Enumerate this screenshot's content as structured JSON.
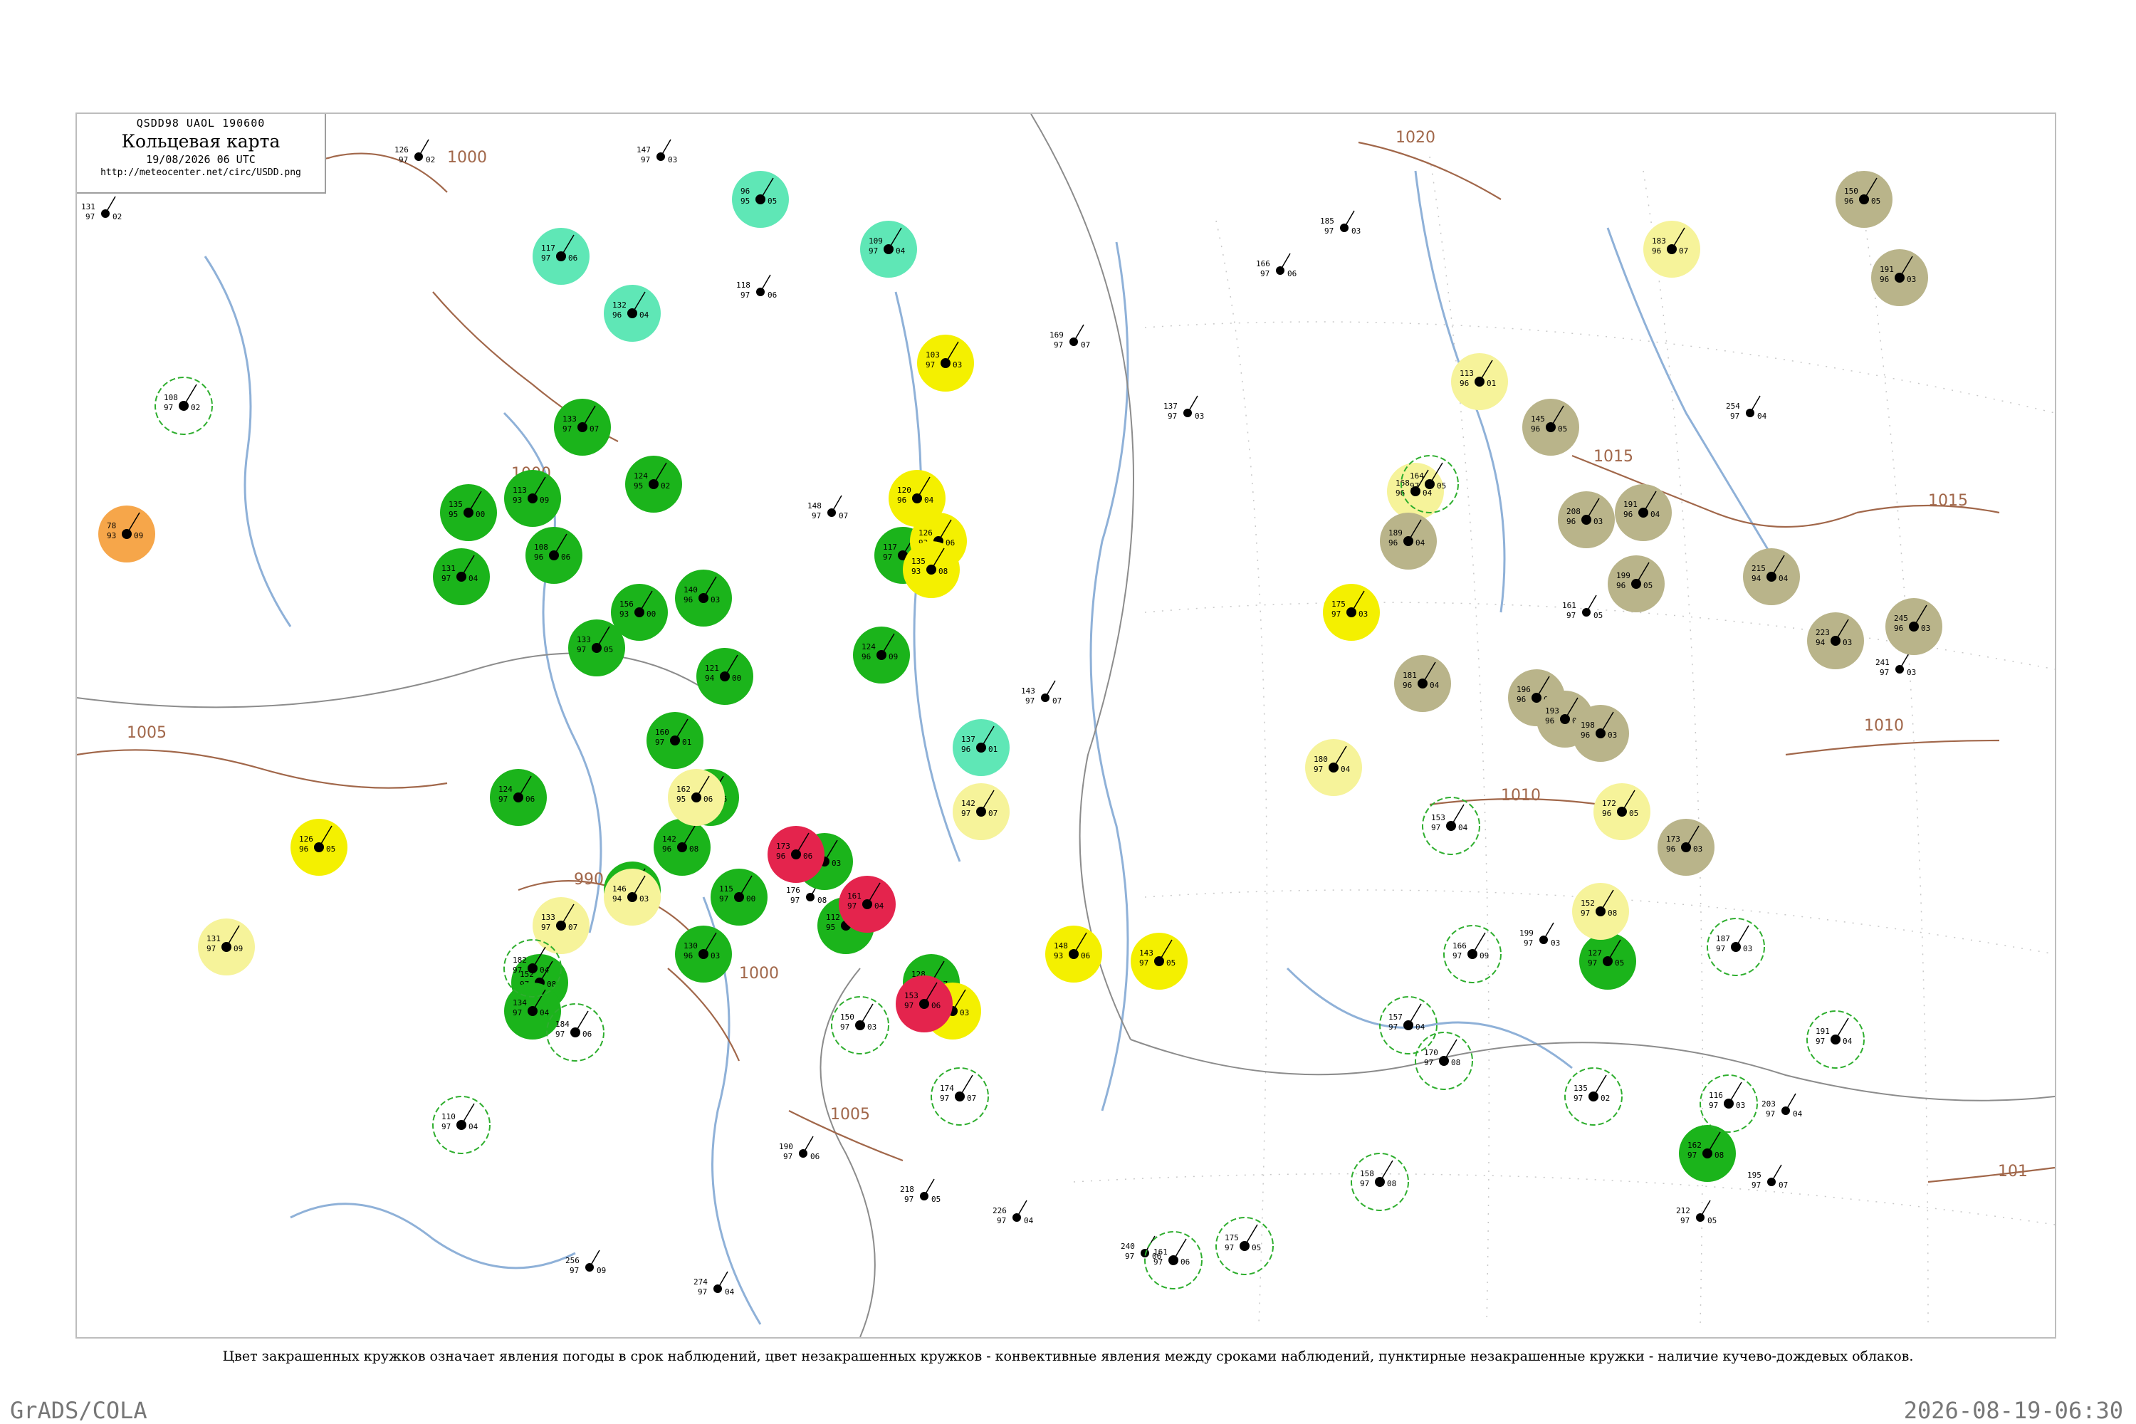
{
  "header": {
    "code_line": "QSDD98  UAOL  190600",
    "title": "Кольцевая карта",
    "date_line": "19/08/2026 06 UTC",
    "url": "http://meteocenter.net/circ/USDD.png"
  },
  "caption": "Цвет закрашенных кружков означает явления погоды в срок наблюдений, цвет незакрашенных кружков - конвективные явления между сроками наблюдений, пунктирные незакрашенные кружки - наличие кучево-дождевых облаков.",
  "footer": {
    "left": "GrADS/COLA",
    "right": "2026-08-19-06:30"
  },
  "colors": {
    "rain_fill": "#1bb41b",
    "shower_ring": "#2eae2e",
    "yellow_fill": "#f4f000",
    "pale_yellow_fill": "#f6f39a",
    "olive_fill": "#b9b48a",
    "red_fill": "#e4244d",
    "orange_fill": "#f6a64a",
    "teal_fill": "#5fe7b6",
    "isobar": "#a1674a",
    "river": "#8fb1d8",
    "border": "#8c8c8c"
  },
  "isobars": [
    {
      "label": "1000"
    },
    {
      "label": "1000"
    },
    {
      "label": "1005"
    },
    {
      "label": "990"
    },
    {
      "label": "1000"
    },
    {
      "label": "1005"
    },
    {
      "label": "1020"
    },
    {
      "label": "1015"
    },
    {
      "label": "1015"
    },
    {
      "label": "1010"
    },
    {
      "label": "1010"
    },
    {
      "label": "101"
    }
  ],
  "stations": [
    {
      "type": "rain_fill",
      "t": "133",
      "p": "97",
      "w": "07"
    },
    {
      "type": "rain_fill",
      "t": "113",
      "p": "93",
      "w": "09"
    },
    {
      "type": "rain_fill",
      "t": "124",
      "p": "95",
      "w": "02"
    },
    {
      "type": "rain_fill",
      "t": "117",
      "p": "97",
      "w": "05"
    },
    {
      "type": "rain_fill",
      "t": "108",
      "p": "96",
      "w": "06"
    },
    {
      "type": "rain_fill",
      "t": "156",
      "p": "93",
      "w": "00"
    },
    {
      "type": "rain_fill",
      "t": "140",
      "p": "96",
      "w": "03"
    },
    {
      "type": "rain_fill",
      "t": "121",
      "p": "94",
      "w": "00"
    },
    {
      "type": "rain_fill",
      "t": "135",
      "p": "95",
      "w": "00"
    },
    {
      "type": "rain_fill",
      "t": "131",
      "p": "97",
      "w": "04"
    },
    {
      "type": "rain_fill",
      "t": "160",
      "p": "97",
      "w": "01"
    },
    {
      "type": "rain_fill",
      "t": "124",
      "p": "96",
      "w": "09"
    },
    {
      "type": "rain_fill",
      "t": "133",
      "p": "97",
      "w": "05"
    },
    {
      "type": "rain_fill",
      "t": "146",
      "p": "96",
      "w": "06"
    },
    {
      "type": "rain_fill",
      "t": "142",
      "p": "96",
      "w": "08"
    },
    {
      "type": "rain_fill",
      "t": "115",
      "p": "97",
      "w": "00"
    },
    {
      "type": "rain_fill",
      "t": "126",
      "p": "97",
      "w": "03"
    },
    {
      "type": "rain_fill",
      "t": "112",
      "p": "95",
      "w": "04"
    },
    {
      "type": "rain_fill",
      "t": "131",
      "p": "97",
      "w": "01"
    },
    {
      "type": "rain_fill",
      "t": "130",
      "p": "96",
      "w": "03"
    },
    {
      "type": "rain_fill",
      "t": "152",
      "p": "97",
      "w": "08"
    },
    {
      "type": "rain_fill",
      "t": "134",
      "p": "97",
      "w": "04"
    },
    {
      "type": "rain_fill",
      "t": "124",
      "p": "97",
      "w": "06"
    },
    {
      "type": "rain_fill",
      "t": "128",
      "p": "96",
      "w": "07"
    },
    {
      "type": "rain_fill",
      "t": "127",
      "p": "97",
      "w": "05"
    },
    {
      "type": "rain_fill",
      "t": "162",
      "p": "97",
      "w": "08"
    },
    {
      "type": "yellow_fill",
      "t": "126",
      "p": "93",
      "w": "06"
    },
    {
      "type": "yellow_fill",
      "t": "120",
      "p": "96",
      "w": "04"
    },
    {
      "type": "yellow_fill",
      "t": "135",
      "p": "93",
      "w": "08"
    },
    {
      "type": "yellow_fill",
      "t": "103",
      "p": "97",
      "w": "03"
    },
    {
      "type": "yellow_fill",
      "t": "126",
      "p": "96",
      "w": "05"
    },
    {
      "type": "yellow_fill",
      "t": "175",
      "p": "97",
      "w": "03"
    },
    {
      "type": "yellow_fill",
      "t": "148",
      "p": "93",
      "w": "06"
    },
    {
      "type": "yellow_fill",
      "t": "143",
      "p": "97",
      "w": "05"
    },
    {
      "type": "yellow_fill",
      "t": "169",
      "p": "93",
      "w": "03"
    },
    {
      "type": "pale_yellow_fill",
      "t": "131",
      "p": "97",
      "w": "09"
    },
    {
      "type": "pale_yellow_fill",
      "t": "146",
      "p": "94",
      "w": "03"
    },
    {
      "type": "pale_yellow_fill",
      "t": "162",
      "p": "95",
      "w": "06"
    },
    {
      "type": "pale_yellow_fill",
      "t": "142",
      "p": "97",
      "w": "07"
    },
    {
      "type": "pale_yellow_fill",
      "t": "183",
      "p": "96",
      "w": "07"
    },
    {
      "type": "pale_yellow_fill",
      "t": "168",
      "p": "96",
      "w": "04"
    },
    {
      "type": "pale_yellow_fill",
      "t": "113",
      "p": "96",
      "w": "01"
    },
    {
      "type": "pale_yellow_fill",
      "t": "180",
      "p": "97",
      "w": "04"
    },
    {
      "type": "pale_yellow_fill",
      "t": "172",
      "p": "96",
      "w": "05"
    },
    {
      "type": "pale_yellow_fill",
      "t": "152",
      "p": "97",
      "w": "08"
    },
    {
      "type": "pale_yellow_fill",
      "t": "133",
      "p": "97",
      "w": "07"
    },
    {
      "type": "olive_fill",
      "t": "150",
      "p": "96",
      "w": "05"
    },
    {
      "type": "olive_fill",
      "t": "191",
      "p": "96",
      "w": "03"
    },
    {
      "type": "olive_fill",
      "t": "145",
      "p": "96",
      "w": "05"
    },
    {
      "type": "olive_fill",
      "t": "189",
      "p": "96",
      "w": "04"
    },
    {
      "type": "olive_fill",
      "t": "208",
      "p": "96",
      "w": "03"
    },
    {
      "type": "olive_fill",
      "t": "191",
      "p": "96",
      "w": "04"
    },
    {
      "type": "olive_fill",
      "t": "199",
      "p": "96",
      "w": "05"
    },
    {
      "type": "olive_fill",
      "t": "181",
      "p": "96",
      "w": "04"
    },
    {
      "type": "olive_fill",
      "t": "196",
      "p": "96",
      "w": "02"
    },
    {
      "type": "olive_fill",
      "t": "193",
      "p": "96",
      "w": "07"
    },
    {
      "type": "olive_fill",
      "t": "198",
      "p": "96",
      "w": "03"
    },
    {
      "type": "olive_fill",
      "t": "215",
      "p": "94",
      "w": "04"
    },
    {
      "type": "olive_fill",
      "t": "223",
      "p": "94",
      "w": "03"
    },
    {
      "type": "olive_fill",
      "t": "245",
      "p": "96",
      "w": "03"
    },
    {
      "type": "olive_fill",
      "t": "173",
      "p": "96",
      "w": "03"
    },
    {
      "type": "red_fill",
      "t": "173",
      "p": "96",
      "w": "06"
    },
    {
      "type": "red_fill",
      "t": "161",
      "p": "97",
      "w": "04"
    },
    {
      "type": "red_fill",
      "t": "153",
      "p": "97",
      "w": "06"
    },
    {
      "type": "orange_fill",
      "t": "78",
      "p": "93",
      "w": "09"
    },
    {
      "type": "teal_fill",
      "t": "117",
      "p": "97",
      "w": "06"
    },
    {
      "type": "teal_fill",
      "t": "132",
      "p": "96",
      "w": "04"
    },
    {
      "type": "teal_fill",
      "t": "109",
      "p": "97",
      "w": "04"
    },
    {
      "type": "teal_fill",
      "t": "137",
      "p": "96",
      "w": "01"
    },
    {
      "type": "teal_fill",
      "t": "96",
      "p": "95",
      "w": "05"
    },
    {
      "type": "shower_ring",
      "t": "108",
      "p": "97",
      "w": "02"
    },
    {
      "type": "shower_ring",
      "t": "110",
      "p": "97",
      "w": "04"
    },
    {
      "type": "shower_ring",
      "t": "164",
      "p": "97",
      "w": "05"
    },
    {
      "type": "shower_ring",
      "t": "153",
      "p": "97",
      "w": "04"
    },
    {
      "type": "shower_ring",
      "t": "166",
      "p": "97",
      "w": "09"
    },
    {
      "type": "shower_ring",
      "t": "116",
      "p": "97",
      "w": "03"
    },
    {
      "type": "shower_ring",
      "t": "182",
      "p": "97",
      "w": "04"
    },
    {
      "type": "shower_ring",
      "t": "184",
      "p": "97",
      "w": "06"
    },
    {
      "type": "shower_ring",
      "t": "170",
      "p": "97",
      "w": "08"
    },
    {
      "type": "shower_ring",
      "t": "135",
      "p": "97",
      "w": "02"
    },
    {
      "type": "shower_ring",
      "t": "158",
      "p": "97",
      "w": "08"
    },
    {
      "type": "shower_ring",
      "t": "175",
      "p": "97",
      "w": "05"
    },
    {
      "type": "shower_ring",
      "t": "161",
      "p": "97",
      "w": "06"
    },
    {
      "type": "shower_ring",
      "t": "150",
      "p": "97",
      "w": "03"
    },
    {
      "type": "shower_ring",
      "t": "174",
      "p": "97",
      "w": "07"
    },
    {
      "type": "shower_ring",
      "t": "157",
      "p": "97",
      "w": "04"
    },
    {
      "type": "shower_ring",
      "t": "187",
      "p": "97",
      "w": "03"
    },
    {
      "type": "shower_ring",
      "t": "191",
      "p": "97",
      "w": "04"
    }
  ],
  "plain_stations": [
    {
      "t": "131",
      "p": "97",
      "w": "02"
    },
    {
      "t": "126",
      "p": "97",
      "w": "02"
    },
    {
      "t": "147",
      "p": "97",
      "w": "03"
    },
    {
      "t": "118",
      "p": "97",
      "w": "06"
    },
    {
      "t": "169",
      "p": "97",
      "w": "07"
    },
    {
      "t": "166",
      "p": "97",
      "w": "06"
    },
    {
      "t": "185",
      "p": "97",
      "w": "03"
    },
    {
      "t": "203",
      "p": "97",
      "w": "04"
    },
    {
      "t": "195",
      "p": "97",
      "w": "07"
    },
    {
      "t": "212",
      "p": "97",
      "w": "05"
    },
    {
      "t": "254",
      "p": "97",
      "w": "04"
    },
    {
      "t": "241",
      "p": "97",
      "w": "03"
    },
    {
      "t": "137",
      "p": "97",
      "w": "03"
    },
    {
      "t": "148",
      "p": "97",
      "w": "07"
    },
    {
      "t": "176",
      "p": "97",
      "w": "08"
    },
    {
      "t": "190",
      "p": "97",
      "w": "06"
    },
    {
      "t": "218",
      "p": "97",
      "w": "05"
    },
    {
      "t": "226",
      "p": "97",
      "w": "04"
    },
    {
      "t": "240",
      "p": "97",
      "w": "06"
    },
    {
      "t": "256",
      "p": "97",
      "w": "09"
    },
    {
      "t": "274",
      "p": "97",
      "w": "04"
    },
    {
      "t": "199",
      "p": "97",
      "w": "03"
    },
    {
      "t": "161",
      "p": "97",
      "w": "05"
    },
    {
      "t": "143",
      "p": "97",
      "w": "07"
    }
  ]
}
